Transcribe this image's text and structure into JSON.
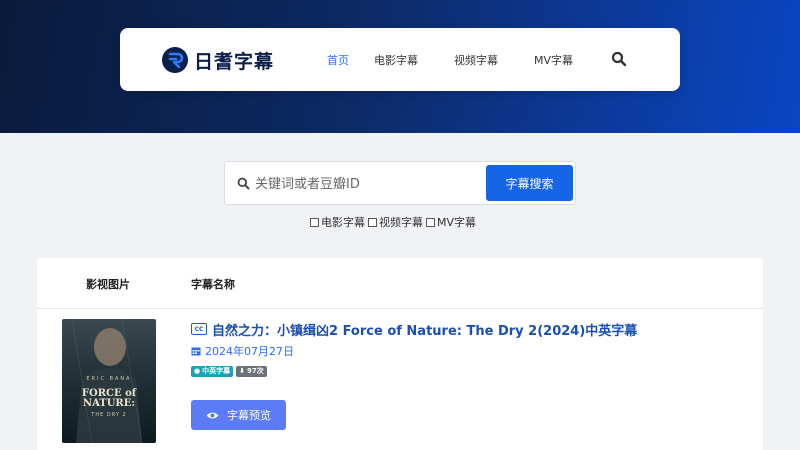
{
  "brand": {
    "name": "日耆字幕"
  },
  "nav": {
    "items": [
      {
        "label": "首页",
        "active": true
      },
      {
        "label": "电影字幕",
        "active": false
      },
      {
        "label": "视频字幕",
        "active": false
      },
      {
        "label": "MV字幕",
        "active": false
      }
    ],
    "search_icon": "search-icon"
  },
  "search": {
    "placeholder": "关键词或者豆瓣ID",
    "value": "",
    "button_label": "字幕搜索"
  },
  "filters": [
    {
      "label": "电影字幕",
      "checked": false
    },
    {
      "label": "视频字幕",
      "checked": false
    },
    {
      "label": "MV字幕",
      "checked": false
    }
  ],
  "table": {
    "headers": {
      "image": "影视图片",
      "name": "字幕名称"
    },
    "rows": [
      {
        "poster": {
          "top_text": "ERIC BANA",
          "title": "FORCE of NATURE:",
          "subtitle": "THE DRY 2"
        },
        "title": "自然之力：小镇缉凶2 Force of Nature: The Dry 2(2024)中英字幕",
        "date": "2024年07月27日",
        "language_badge": "中英字幕",
        "download_badge": "97次",
        "preview_label": "字幕预览"
      }
    ]
  },
  "colors": {
    "accent": "#2b6cf0",
    "search_button": "#1565e6",
    "preview_button": "#5b7cf5",
    "lang_badge": "#1aa3b8",
    "count_badge": "#6b7178"
  }
}
